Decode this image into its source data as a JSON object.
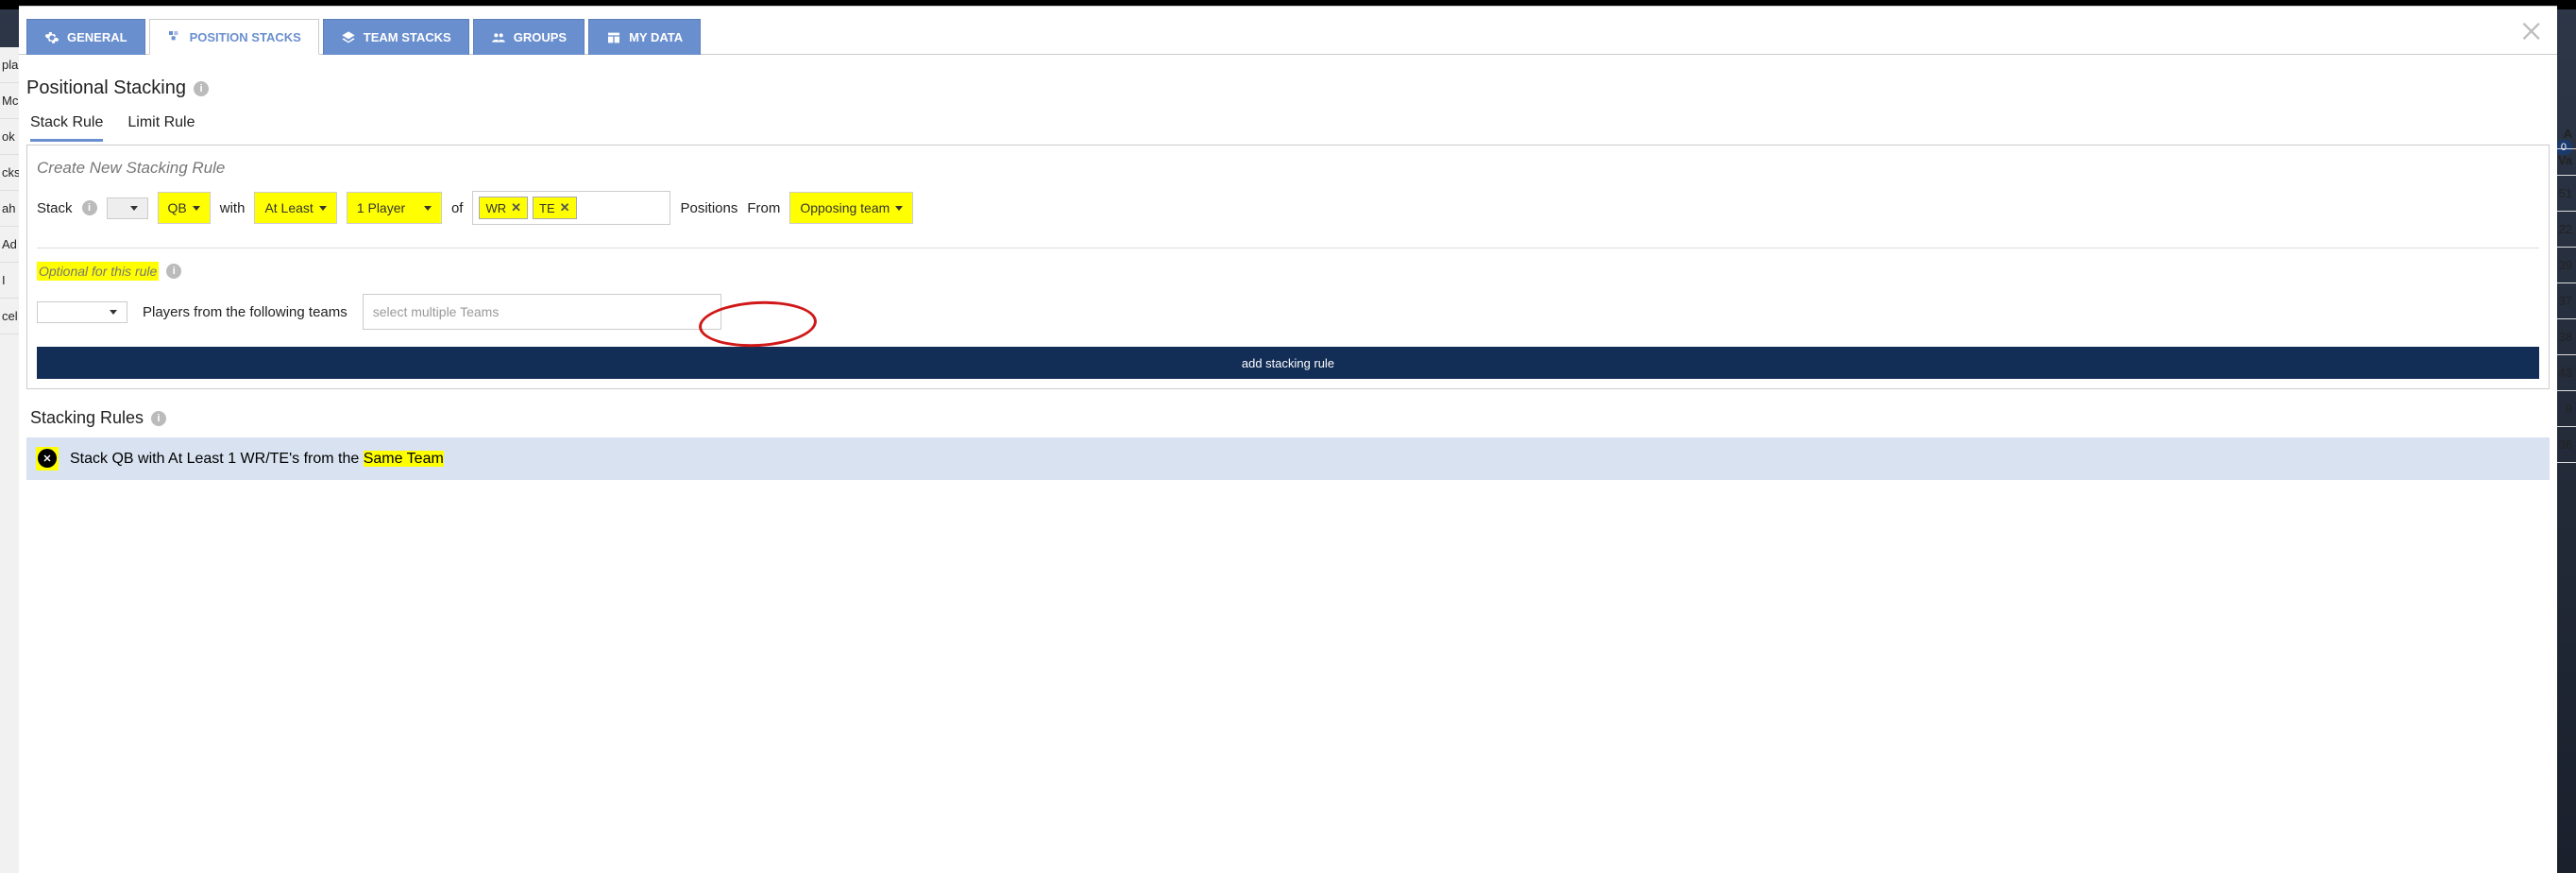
{
  "bg": {
    "left_rows": [
      "pla",
      "Mc",
      "ok",
      "cks",
      "ah",
      "Ad",
      "I",
      "cel"
    ],
    "right_header_a": "A",
    "right_header_va": "Va",
    "right_rows": [
      "51",
      "22",
      "39",
      "37",
      "38",
      "43",
      "9",
      "38"
    ],
    "badge_right": "0"
  },
  "tabs": [
    {
      "label": "GENERAL",
      "icon": "gear"
    },
    {
      "label": "POSITION STACKS",
      "icon": "stacks",
      "active": true
    },
    {
      "label": "TEAM STACKS",
      "icon": "layers"
    },
    {
      "label": "GROUPS",
      "icon": "people"
    },
    {
      "label": "MY DATA",
      "icon": "table"
    }
  ],
  "section_title": "Positional Stacking",
  "subtabs": {
    "stack_rule": "Stack Rule",
    "limit_rule": "Limit Rule"
  },
  "rule_box": {
    "title": "Create New Stacking Rule",
    "stack_label": "Stack",
    "qb_dd": "QB",
    "with_label": "with",
    "atleast_dd": "At Least",
    "count_dd": "1 Player",
    "of_label": "of",
    "tokens": [
      "WR",
      "TE"
    ],
    "positions_label": "Positions",
    "from_label": "From",
    "team_dd": "Opposing team",
    "optional_label": "Optional for this rule",
    "teams_label": "Players from the following teams",
    "teams_placeholder": "select multiple Teams",
    "add_btn": "add stacking rule"
  },
  "rules_title": "Stacking Rules",
  "existing_rule": {
    "prefix": "Stack QB with At Least 1 WR/TE's from the ",
    "hl": "Same Team"
  }
}
